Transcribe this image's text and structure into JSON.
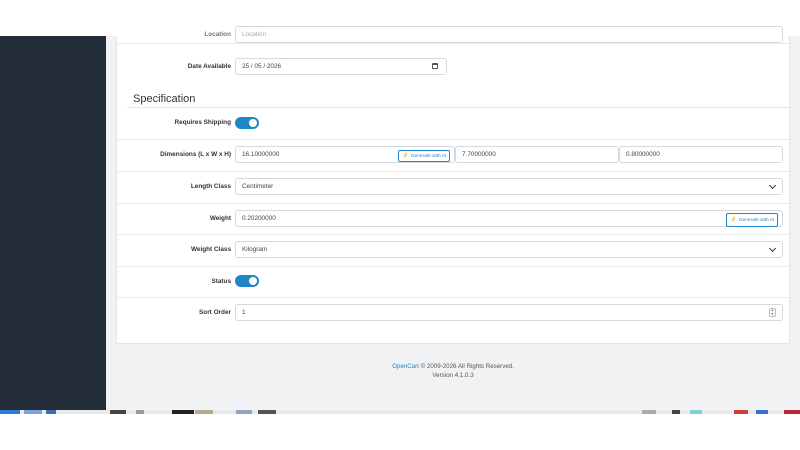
{
  "form": {
    "location": {
      "label": "Location",
      "value": "Location"
    },
    "date_available": {
      "label": "Date Available",
      "value": "25 / 05 / 2026"
    },
    "specification": {
      "title": "Specification",
      "requires_shipping": {
        "label": "Requires Shipping",
        "checked": true
      },
      "dimensions": {
        "label": "Dimensions (L x W x H)",
        "length": "16.10000000",
        "width": "7.70000000",
        "height": "0.80000000",
        "ai_button": "Generate with AI"
      },
      "length_class": {
        "label": "Length Class",
        "value": "Centimeter"
      },
      "weight": {
        "label": "Weight",
        "value": "0.20200000",
        "ai_button": "Generate with AI"
      },
      "weight_class": {
        "label": "Weight Class",
        "value": "Kilogram"
      },
      "status": {
        "label": "Status",
        "checked": true
      },
      "sort_order": {
        "label": "Sort Order",
        "value": "1"
      }
    }
  },
  "footer": {
    "brand": "OpenCart",
    "copyright": "© 2009-2026 All Rights Reserved.",
    "version": "Version 4.1.0.3"
  },
  "colors": {
    "sidebar": "#232d3a",
    "accent": "#1e88c7",
    "background": "#f1f2f4"
  }
}
